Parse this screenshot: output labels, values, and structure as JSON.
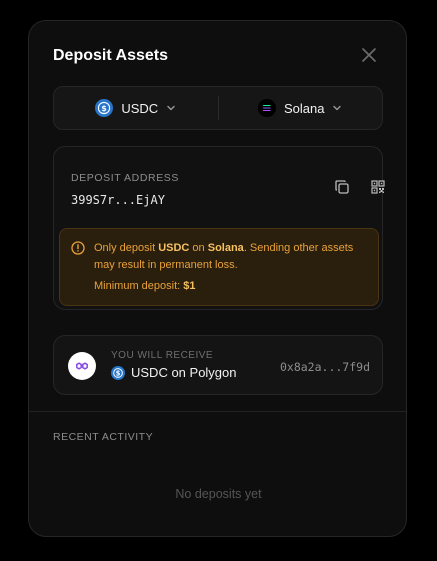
{
  "dialog": {
    "title": "Deposit Assets",
    "close_icon": "close-icon"
  },
  "selector": {
    "asset": {
      "label": "USDC",
      "icon": "usdc-icon",
      "color": "#2775ca"
    },
    "network": {
      "label": "Solana",
      "icon": "solana-icon",
      "color": "#9945ff"
    }
  },
  "deposit": {
    "label": "DEPOSIT ADDRESS",
    "address": "399S7r...EjAY",
    "copy_icon": "copy-icon",
    "qr_icon": "qr-code-icon"
  },
  "warning": {
    "prefix": "Only deposit ",
    "asset": "USDC",
    "middle": " on ",
    "network": "Solana",
    "suffix": ". Sending other assets may result in permanent loss.",
    "min_label": "Minimum deposit: ",
    "min_value": "$1",
    "color": "#e9a23b"
  },
  "receive": {
    "label": "YOU WILL RECEIVE",
    "value": "USDC on Polygon",
    "address": "0x8a2a...7f9d",
    "network_icon": "polygon-icon",
    "asset_icon": "usdc-icon"
  },
  "activity": {
    "label": "RECENT ACTIVITY",
    "empty": "No deposits yet"
  }
}
